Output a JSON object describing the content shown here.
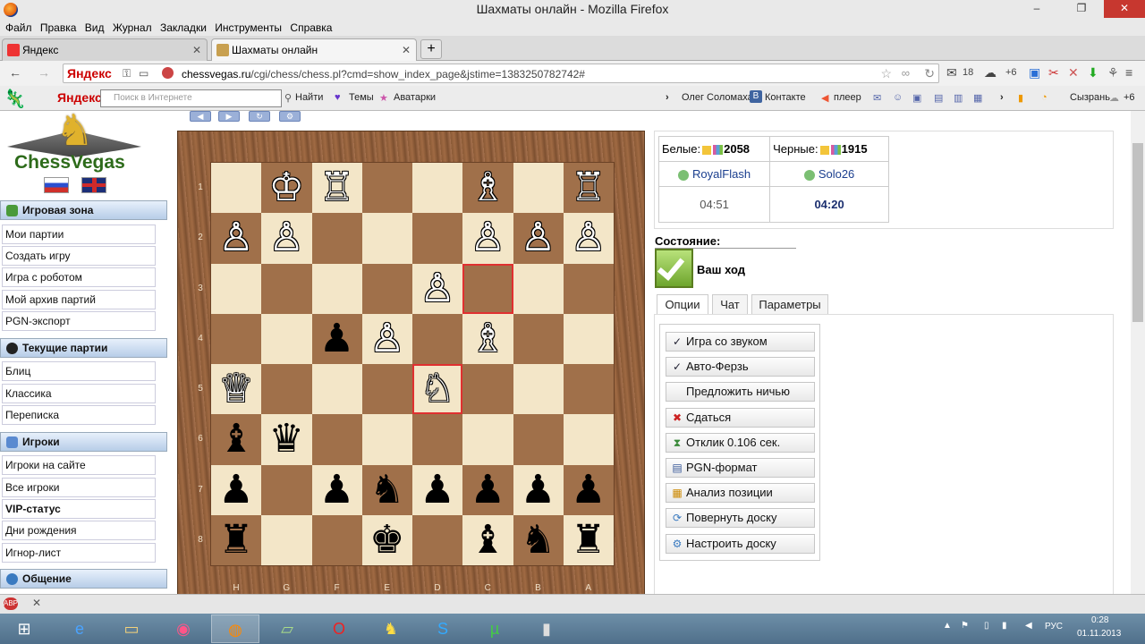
{
  "window": {
    "title": "Шахматы онлайн - Mozilla Firefox",
    "minimize": "–",
    "maximize": "❐",
    "close": "✕"
  },
  "menu": [
    "Файл",
    "Правка",
    "Вид",
    "Журнал",
    "Закладки",
    "Инструменты",
    "Справка"
  ],
  "tabs": [
    {
      "label": "Яндекс",
      "active": false
    },
    {
      "label": "Шахматы онлайн",
      "active": true
    }
  ],
  "tab_close": "✕",
  "new_tab": "+",
  "nav": {
    "back": "←",
    "forward": "→",
    "yandex_logo": "Яндекс",
    "url_host": "chessvegas.ru",
    "url_path": "/cgi/chess/chess.pl?cmd=show_index_page&jstime=1383250782742#",
    "mail_count": "18",
    "weather": "+6"
  },
  "yandex_bar": {
    "logo": "Яндекс",
    "search_placeholder": "Поиск в Интернете",
    "find": "Найти",
    "themes": "Темы",
    "avatars": "Аватарки",
    "user": "Олег Соломаха",
    "vk": "Контакте",
    "player": "плеер",
    "city": "Сызрань",
    "city_temp": "+6"
  },
  "sidebar": {
    "logo_text": "ChessVegas",
    "sections": [
      {
        "title": "Игровая зона",
        "items": [
          "Мои партии",
          "Создать игру",
          "Игра с роботом",
          "Мой архив партий",
          "PGN-экспорт"
        ]
      },
      {
        "title": "Текущие партии",
        "items": [
          "Блиц",
          "Классика",
          "Переписка"
        ]
      },
      {
        "title": "Игроки",
        "items": [
          "Игроки на сайте",
          "Все игроки",
          "VIP-статус",
          "Дни рождения",
          "Игнор-лист"
        ]
      },
      {
        "title": "Общение",
        "items": []
      }
    ]
  },
  "board": {
    "ranks": [
      "1",
      "2",
      "3",
      "4",
      "5",
      "6",
      "7",
      "8"
    ],
    "files": [
      "H",
      "G",
      "F",
      "E",
      "D",
      "C",
      "B",
      "A"
    ],
    "pieces": [
      {
        "sq": "G1",
        "p": "♔",
        "c": "w"
      },
      {
        "sq": "F1",
        "p": "♖",
        "c": "w"
      },
      {
        "sq": "C1",
        "p": "♗",
        "c": "w"
      },
      {
        "sq": "A1",
        "p": "♖",
        "c": "w"
      },
      {
        "sq": "H2",
        "p": "♙",
        "c": "w"
      },
      {
        "sq": "G2",
        "p": "♙",
        "c": "w"
      },
      {
        "sq": "C2",
        "p": "♙",
        "c": "w"
      },
      {
        "sq": "B2",
        "p": "♙",
        "c": "w"
      },
      {
        "sq": "A2",
        "p": "♙",
        "c": "w"
      },
      {
        "sq": "D3",
        "p": "♙",
        "c": "w"
      },
      {
        "sq": "F4",
        "p": "♟",
        "c": "b"
      },
      {
        "sq": "E4",
        "p": "♙",
        "c": "w"
      },
      {
        "sq": "C4",
        "p": "♗",
        "c": "w"
      },
      {
        "sq": "H5",
        "p": "♕",
        "c": "w"
      },
      {
        "sq": "D5",
        "p": "♘",
        "c": "w"
      },
      {
        "sq": "H6",
        "p": "♝",
        "c": "b"
      },
      {
        "sq": "G6",
        "p": "♛",
        "c": "b"
      },
      {
        "sq": "H7",
        "p": "♟",
        "c": "b"
      },
      {
        "sq": "F7",
        "p": "♟",
        "c": "b"
      },
      {
        "sq": "E7",
        "p": "♞",
        "c": "b"
      },
      {
        "sq": "D7",
        "p": "♟",
        "c": "b"
      },
      {
        "sq": "C7",
        "p": "♟",
        "c": "b"
      },
      {
        "sq": "B7",
        "p": "♟",
        "c": "b"
      },
      {
        "sq": "A7",
        "p": "♟",
        "c": "b"
      },
      {
        "sq": "H8",
        "p": "♜",
        "c": "b"
      },
      {
        "sq": "E8",
        "p": "♚",
        "c": "b"
      },
      {
        "sq": "C8",
        "p": "♝",
        "c": "b"
      },
      {
        "sq": "B8",
        "p": "♞",
        "c": "b"
      },
      {
        "sq": "A8",
        "p": "♜",
        "c": "b"
      }
    ],
    "highlight": [
      "C3",
      "D5"
    ]
  },
  "players": {
    "white_label": "Белые:",
    "white_rating": "2058",
    "black_label": "Черные:",
    "black_rating": "1915",
    "white_name": "RoyalFlash",
    "black_name": "Solo26",
    "white_clock": "04:51",
    "black_clock": "04:20"
  },
  "status": {
    "title": "Состояние:",
    "text": "Ваш ход"
  },
  "option_tabs": [
    "Опции",
    "Чат",
    "Параметры"
  ],
  "options": [
    {
      "icon": "✓",
      "label": "Игра со звуком"
    },
    {
      "icon": "✓",
      "label": "Авто-Ферзь"
    },
    {
      "icon": "",
      "label": "Предложить ничью"
    },
    {
      "icon": "✖",
      "label": "Сдаться"
    },
    {
      "icon": "⧗",
      "label": "Отклик 0.106 сек."
    },
    {
      "icon": "▤",
      "label": "PGN-формат"
    },
    {
      "icon": "▦",
      "label": "Анализ позиции"
    },
    {
      "icon": "⟳",
      "label": "Повернуть доску"
    },
    {
      "icon": "⚙",
      "label": "Настроить доску"
    }
  ],
  "taskbar": {
    "lang": "РУС",
    "time": "0:28",
    "date": "01.11.2013"
  },
  "colors": {
    "accent": "#1b3f8f",
    "highlight": "#e03030",
    "light_square": "#f3e6c8",
    "dark_square": "#a0704a"
  }
}
